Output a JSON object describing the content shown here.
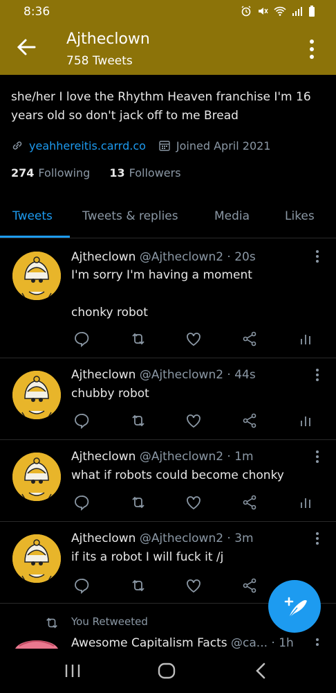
{
  "status": {
    "time": "8:36"
  },
  "header": {
    "name": "Ajtheclown",
    "tweet_count": "758 Tweets"
  },
  "profile": {
    "bio": "she/her I love the Rhythm Heaven franchise  I'm 16 years old so don't jack off to me Bread",
    "link": "yeahhereitis.carrd.co",
    "joined": "Joined April 2021",
    "following_count": "274",
    "following_label": "Following",
    "followers_count": "13",
    "followers_label": "Followers"
  },
  "tabs": [
    "Tweets",
    "Tweets & replies",
    "Media",
    "Likes"
  ],
  "tweets": [
    {
      "name": "Ajtheclown",
      "handle": "@Ajtheclown2 · 20s",
      "text": "I'm sorry I'm having a moment\n\nchonky robot"
    },
    {
      "name": "Ajtheclown",
      "handle": "@Ajtheclown2 · 44s",
      "text": "chubby robot"
    },
    {
      "name": "Ajtheclown",
      "handle": "@Ajtheclown2 · 1m",
      "text": "what if robots could become chonky"
    },
    {
      "name": "Ajtheclown",
      "handle": "@Ajtheclown2 · 3m",
      "text": "if its  a robot I will fuck it /j"
    }
  ],
  "retweet": {
    "label": "You Retweeted",
    "name": "Awesome Capitalism Facts",
    "handle": "@ca...  · 1h"
  },
  "colors": {
    "header": "#8c7309",
    "accent": "#1d9bf0",
    "background": "#000000"
  }
}
